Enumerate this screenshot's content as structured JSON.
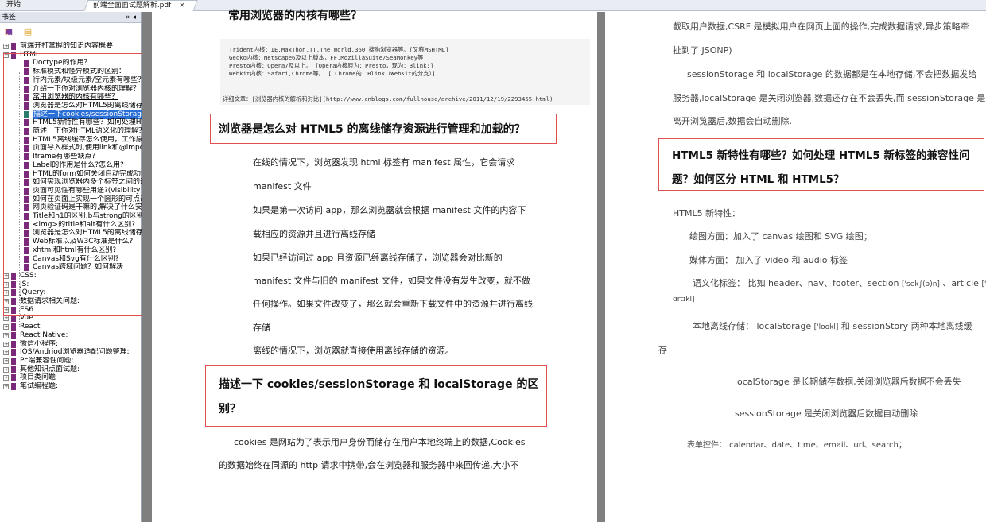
{
  "tabs": {
    "home": "开始",
    "doc": "前端全面面试题解析.pdf",
    "close": "×"
  },
  "sidebar": {
    "title": "书签",
    "controls": "» ◂",
    "top_item": "前端开打掌握的知识内容概要",
    "html_section": "HTML:",
    "html_items": [
      "Doctype的作用？",
      "标准模式和怪异模式的区别：",
      "行内元素/块级元素/空元素有哪些？",
      "介绍一下你对浏览器内核的理解？",
      "常用浏览器的内核有哪些？",
      "浏览器是怎么对HTML5的离线储存资",
      "描述一下cookies/sessionStorage和l",
      "HTML5新特性有哪些？如何处理HTM",
      "简述一下你对HTML语义化的理解？",
      "HTML5离线缓存怎么使用，工作原理",
      "页面导入样式时,使用link和@import",
      "Iframe有哪些缺点？",
      "Label的作用是什么?怎么用?",
      "HTML的form如何关闭自动完成功能",
      "如何实现浏览器内多个标签之间的通",
      "页面可见性有哪些用途?(visibility AP",
      "如何在页面上实现一个圆形的可点击",
      "网页验证码是干嘛的,解决了什么安全",
      "Title和h1的区别,b与strong的区别,i",
      "<img>的title和alt有什么区别?",
      "浏览器是怎么对HTML5的离线储存资",
      "Web标准以及W3C标准是什么?",
      "xhtml和html有什么区别?",
      "Canvas和Svg有什么区别?",
      "Canvas跨域问题？如何解决"
    ],
    "sections": [
      "CSS:",
      "JS:",
      "JQuery:",
      "数据请求相关问题:",
      "ES6",
      "Vue",
      "React",
      "React Native:",
      "微信小程序:",
      "IOS/Andriod浏览器适配问题整理:",
      "Pc端兼容性问题:",
      "其他知识点面试题:",
      "项目类问题",
      "笔试编程题:"
    ]
  },
  "page1": {
    "cut_heading": "常用浏览器的内核有哪些？",
    "code_lines": [
      "Trident内核：IE,MaxThon,TT,The World,360,搜狗浏览器等。[又称MSHTML]",
      "Gecko内核：Netscape6及以上版本，FF,MozillaSuite/SeaMonkey等",
      "Presto内核：Opera7及以上。      [Opera内核原为：Presto，现为：Blink;]",
      "Webkit内核：Safari,Chrome等。    [ Chrome的：Blink（WebKit的分支）]"
    ],
    "code_ref": "详细文章：[浏览器内核的解析和对比](http://www.cnblogs.com/fullhouse/archive/2011/12/19/2293455.html)",
    "heading2": "浏览器是怎么对 HTML5 的离线储存资源进行管理和加载的？",
    "paras": [
      "在线的情况下，浏览器发现 html 标签有 manifest 属性，它会请求",
      "manifest 文件",
      "如果是第一次访问 app，那么浏览器就会根据 manifest 文件的内容下",
      "载相应的资源并且进行离线存储",
      "如果已经访问过 app 且资源已经离线存储了，浏览器会对比新的",
      "manifest 文件与旧的 manifest 文件，如果文件没有发生改变，就不做",
      "任何操作。如果文件改变了，那么就会重新下载文件中的资源并进行离线",
      "存储",
      "离线的情况下，浏览器就直接使用离线存储的资源。"
    ],
    "heading3_l1": "描述一下 cookies/sessionStorage 和 localStorage 的区",
    "heading3_l2": "别？",
    "tail1": "cookies 是网站为了表示用户身份而储存在用户本地终端上的数据,Cookies",
    "tail2": "的数据始终在同源的 http 请求中携带,会在浏览器和服务器中来回传递,大小不"
  },
  "page2": {
    "l1": "截取用户数据,CSRF 是模拟用户在网页上面的操作,完成数据请求,异步策略牵",
    "l2": "扯到了 JSONP)",
    "l3": "sessionStorage 和 localStorage 的数据都是在本地存储,不会把数据发给",
    "l4": "服务器,localStorage 是关闭浏览器,数据还存在不会丢失,而 sessionStorage 是",
    "l5": "离开浏览器后,数据会自动删除.",
    "heading_l1": "HTML5 新特性有哪些？如何处理 HTML5 新标签的兼容性问",
    "heading_l2": "题？如何区分 HTML 和 HTML5？",
    "f0": "HTML5 新特性：",
    "f1": "绘图方面：加入了 canvas 绘图和 SVG 绘图；",
    "f2": "媒体方面： 加入了 video 和 audio 标签",
    "f3a": "语义化标签： 比如 header、nav、footer、section",
    "f3b": "['sek∫(ə)n]",
    "f3c": "、article",
    "f3d": "['",
    "f3e": "ɑrtɪkl]",
    "f4a": "本地离线存储： localStorage",
    "f4b": "['lookl]",
    "f4c": "和 sessionStory 两种本地离线缓",
    "f4d": "存",
    "f5": "localStorage 是长期储存数据,关闭浏览器后数据不会丢失",
    "f6": "sessionStorage 是关闭浏览器后数据自动删除",
    "f7": "表单控件： calendar、date、time、email、url、search；"
  },
  "colors": {
    "highlight_box": "#e05050",
    "selected_bookmark": "#2a6fd6",
    "bookmark": "#7b2a7b"
  },
  "icons": [
    "bookmark-expand-icon",
    "bookmark-collapse-icon",
    "bookmark-new-icon",
    "bookmark-options-icon"
  ]
}
